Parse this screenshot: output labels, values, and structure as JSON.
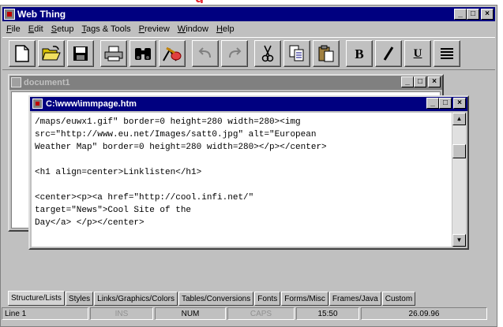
{
  "app": {
    "title": "Web Thing",
    "minimize_label": "_",
    "maximize_label": "□",
    "close_label": "×"
  },
  "menu": [
    "File",
    "Edit",
    "Setup",
    "Tags & Tools",
    "Preview",
    "Window",
    "Help"
  ],
  "toolbar": {
    "buttons": [
      "new-document",
      "open-folder",
      "save",
      "print",
      "find",
      "spell-check",
      "undo",
      "redo",
      "cut",
      "copy",
      "paste",
      "bold",
      "italic",
      "underline",
      "align"
    ],
    "bold_label": "B",
    "underline_label": "U"
  },
  "document1": {
    "title": "document1"
  },
  "document2": {
    "title": "C:\\www\\immpage.htm",
    "lines": [
      "/maps/euwx1.gif\" border=0 height=280 width=280><img",
      "src=\"http://www.eu.net/Images/satt0.jpg\" alt=\"European",
      "Weather Map\" border=0 height=280 width=280></p></center>",
      "",
      "<h1 align=center>Linklisten</h1>",
      "",
      "<center><p><a href=\"http://cool.infi.net/\"",
      "target=\"News\">Cool Site of the",
      "Day</a> </p></center>"
    ]
  },
  "tabs": [
    "Structure/Lists",
    "Styles",
    "Links/Graphics/Colors",
    "Tables/Conversions",
    "Fonts",
    "Forms/Misc",
    "Frames/Java",
    "Custom"
  ],
  "status": {
    "line": "Line 1",
    "ins": "INS",
    "num": "NUM",
    "caps": "CAPS",
    "time": "15:50",
    "date": "26.09.96"
  },
  "colors": {
    "title_active": "#000080",
    "title_inactive": "#808080",
    "face": "#c0c0c0"
  }
}
